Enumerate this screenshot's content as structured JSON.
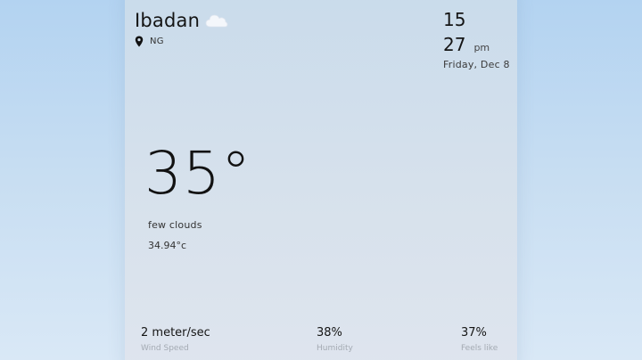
{
  "location": {
    "city": "Ibadan",
    "country": "NG",
    "weather_icon": "cloud-icon",
    "pin_icon": "map-pin-icon"
  },
  "clock": {
    "hour": "15",
    "minute": "27",
    "ampm": "pm",
    "date": "Friday, Dec 8"
  },
  "weather": {
    "temperature": "35°",
    "description": "few clouds",
    "temperature_exact": "34.94°c"
  },
  "stats": [
    {
      "value": "2 meter/sec",
      "label": "Wind Speed"
    },
    {
      "value": "38%",
      "label": "Humidity"
    },
    {
      "value": "37%",
      "label": "Feels like"
    }
  ],
  "colors": {
    "background_top": "#b3d3f1",
    "background_bottom": "#d9e8f6",
    "card": "#d6e1ec",
    "label_muted": "#a4aab3"
  }
}
